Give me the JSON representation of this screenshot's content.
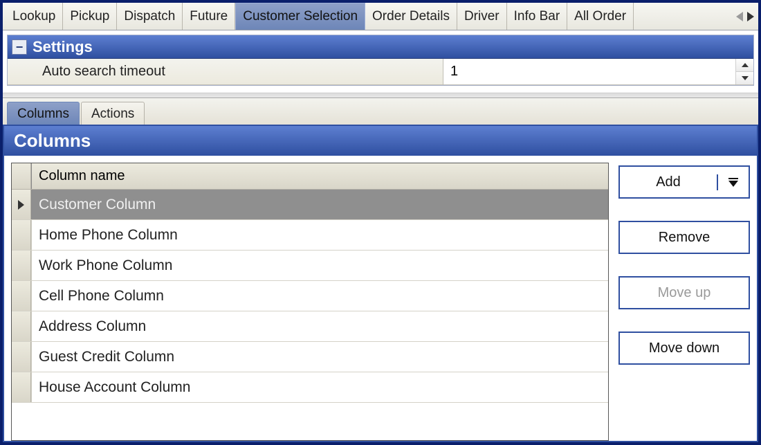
{
  "top_tabs": [
    {
      "label": "Lookup",
      "active": false
    },
    {
      "label": "Pickup",
      "active": false
    },
    {
      "label": "Dispatch",
      "active": false
    },
    {
      "label": "Future",
      "active": false
    },
    {
      "label": "Customer Selection",
      "active": true
    },
    {
      "label": "Order Details",
      "active": false
    },
    {
      "label": "Driver",
      "active": false
    },
    {
      "label": "Info Bar",
      "active": false
    },
    {
      "label": "All Order",
      "active": false
    }
  ],
  "settings": {
    "title": "Settings",
    "rows": [
      {
        "label": "Auto search timeout",
        "value": "1"
      }
    ]
  },
  "inner_tabs": [
    {
      "label": "Columns",
      "active": true
    },
    {
      "label": "Actions",
      "active": false
    }
  ],
  "columns_panel": {
    "title": "Columns",
    "header": "Column name",
    "rows": [
      {
        "name": "Customer Column",
        "selected": true
      },
      {
        "name": "Home Phone Column",
        "selected": false
      },
      {
        "name": "Work Phone Column",
        "selected": false
      },
      {
        "name": "Cell Phone Column",
        "selected": false
      },
      {
        "name": "Address Column",
        "selected": false
      },
      {
        "name": "Guest Credit Column",
        "selected": false
      },
      {
        "name": "House Account Column",
        "selected": false
      }
    ],
    "buttons": {
      "add": "Add",
      "remove": "Remove",
      "move_up": "Move up",
      "move_down": "Move down"
    }
  }
}
